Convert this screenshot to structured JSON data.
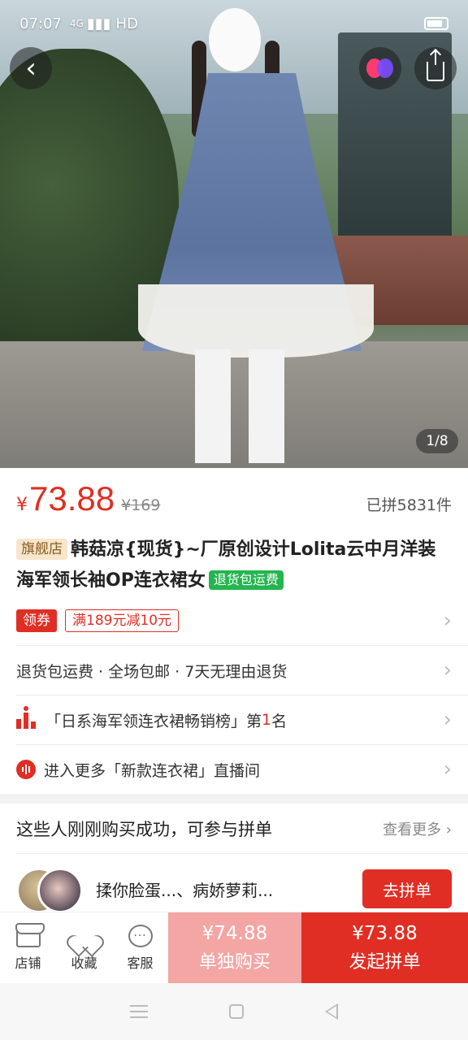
{
  "status_bar": {
    "time": "07:07",
    "signal": "4G",
    "hd": "HD"
  },
  "gallery": {
    "pager": "1/8"
  },
  "price": {
    "currency": "¥",
    "current": "73.88",
    "original": "¥169",
    "sold": "已拼5831件"
  },
  "title": {
    "store_tag": "旗舰店",
    "text": "韩菇凉{现货}~厂原创设计Lolita云中月洋装海军领长袖OP连衣裙女",
    "return_tag": "退货包运费"
  },
  "coupon": {
    "label": "领券",
    "deal": "满189元减10元"
  },
  "services": {
    "text": "退货包运费 · 全场包邮 · 7天无理由退货"
  },
  "ranking": {
    "prefix": "「日系海军领连衣裙畅销榜」第",
    "rank": "1",
    "suffix": "名"
  },
  "live": {
    "text": "进入更多「新款连衣裙」直播间"
  },
  "group_section": {
    "title": "这些人刚刚购买成功，可参与拼单",
    "more": "查看更多",
    "names": "揉你脸蛋...、病娇萝莉...",
    "join": "去拼单"
  },
  "bottom_bar": {
    "shop": "店铺",
    "favorite": "收藏",
    "service": "客服",
    "alone_price": "¥74.88",
    "alone_label": "单独购买",
    "group_price": "¥73.88",
    "group_label": "发起拼单"
  },
  "colors": {
    "accent": "#e02e24",
    "alone_bg": "#f3a6a3",
    "return_tag_bg": "#25b550"
  },
  "icons": [
    "back-icon",
    "brand-heart-icon",
    "share-icon",
    "rank-icon",
    "live-icon",
    "shop-icon",
    "heart-icon",
    "chat-icon",
    "chevron-right-icon"
  ]
}
